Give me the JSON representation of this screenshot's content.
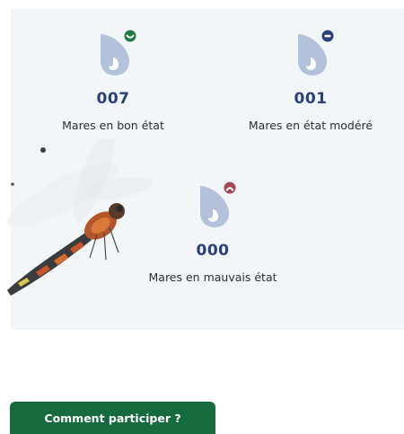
{
  "stats": [
    {
      "count": "007",
      "label": "Mares en bon état",
      "status": "good",
      "status_icon": "smile-icon",
      "status_color": "#1e7a45"
    },
    {
      "count": "001",
      "label": "Mares en état modéré",
      "status": "moderate",
      "status_icon": "minus-icon",
      "status_color": "#2b3f78"
    },
    {
      "count": "000",
      "label": "Mares en mauvais état",
      "status": "bad",
      "status_icon": "frown-icon",
      "status_color": "#a14a55"
    }
  ],
  "drop_icon": {
    "name": "water-drop-icon",
    "color": "#b3c2da"
  },
  "cta": {
    "label": "Comment participer ?",
    "color": "#156b3d"
  },
  "decoration": {
    "image": "dragonfly-image"
  }
}
